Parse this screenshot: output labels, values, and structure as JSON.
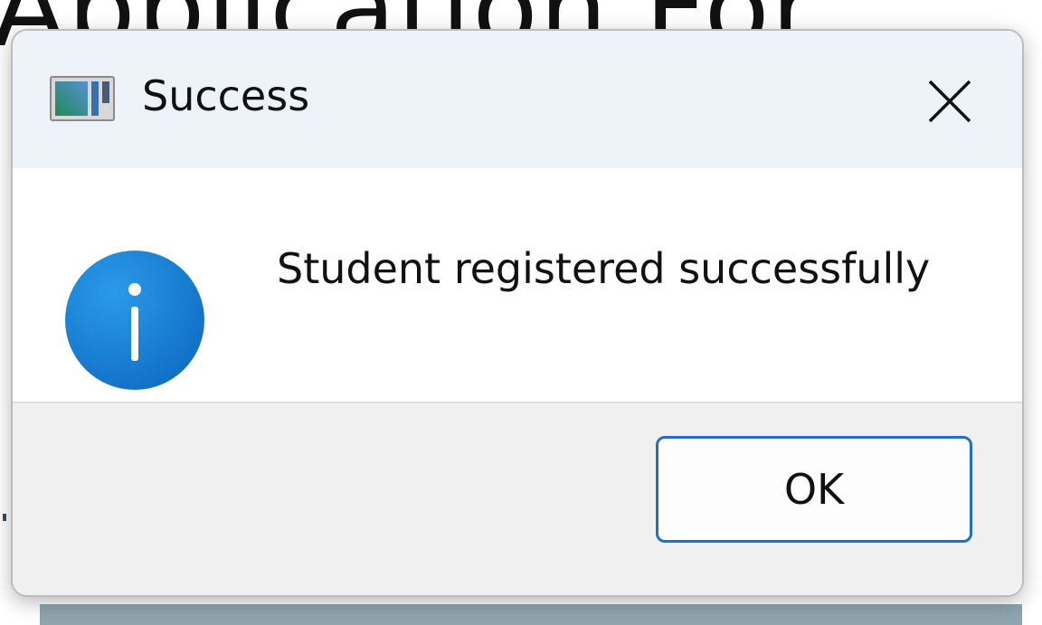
{
  "background": {
    "heading_fragment": "Application For"
  },
  "dialog": {
    "title": "Success",
    "app_icon": "window-app-icon",
    "close_icon": "close-icon",
    "message_icon": "info-icon",
    "message": "Student registered successfully",
    "ok_label": "OK",
    "colors": {
      "titlebar": "#eef2f9",
      "content": "#ffffff",
      "footer": "#f0f0f0",
      "accent": "#1f6fc6",
      "info_icon": "#1a86d9"
    }
  }
}
